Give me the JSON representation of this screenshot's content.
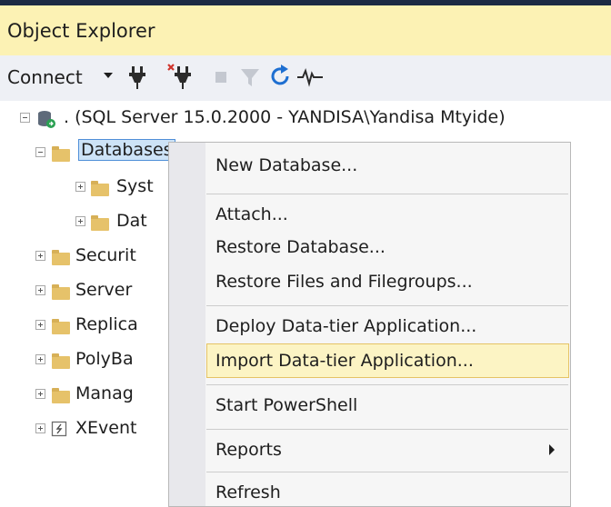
{
  "panel": {
    "title": "Object Explorer"
  },
  "toolbar": {
    "connect_label": "Connect",
    "icons": [
      "connect-plug-icon",
      "disconnect-plug-icon",
      "stop-icon",
      "filter-icon",
      "refresh-icon",
      "activity-monitor-icon"
    ]
  },
  "tree": {
    "server": ". (SQL Server 15.0.2000 - YANDISA\\Yandisa Mtyide)",
    "databases": "Databases",
    "children": [
      "Syst",
      "Dat",
      "Securit",
      "Server",
      "Replica",
      "PolyBa",
      "Manag",
      "XEvent"
    ]
  },
  "context_menu": {
    "items": [
      "New Database...",
      "Attach...",
      "Restore Database...",
      "Restore Files and Filegroups...",
      "Deploy Data-tier Application...",
      "Import Data-tier Application...",
      "Start PowerShell",
      "Reports",
      "Refresh"
    ],
    "highlighted": "Import Data-tier Application..."
  },
  "colors": {
    "title_bg": "#fcf2b4",
    "toolbar_bg": "#eef0f5",
    "highlight_bg": "#fcf4c4",
    "selection_bg": "#cde3f7"
  }
}
